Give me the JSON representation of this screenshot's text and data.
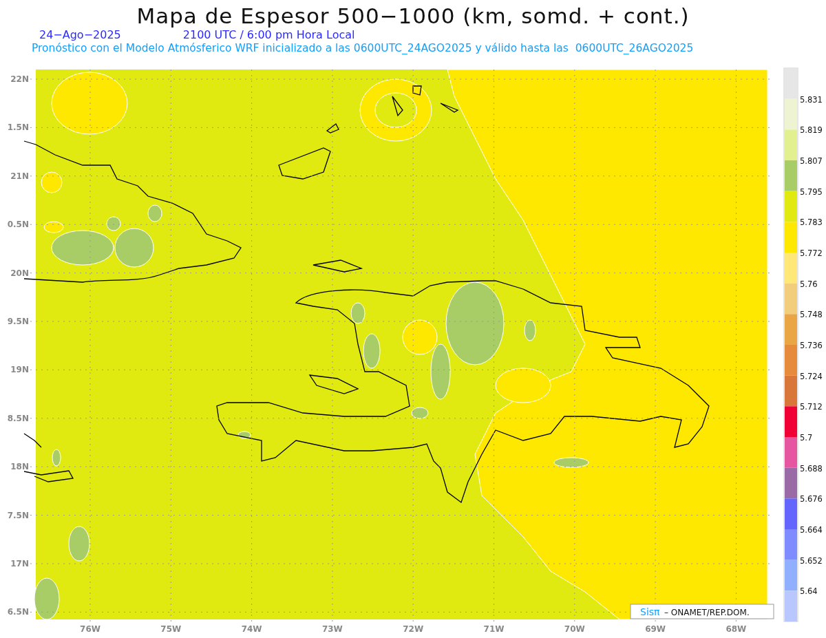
{
  "header": {
    "title": "Mapa de Espesor 500−1000 (km, somd. + cont.)",
    "date": "24−Ago−2025",
    "time": "2100 UTC / 6:00 pm Hora Local",
    "forecast": "Pronóstico con el Modelo Atmósferico WRF inicializado a las 0600UTC_24AGO2025 y válido hasta las  0600UTC_26AGO2025"
  },
  "map": {
    "latitude_labels": [
      "22N",
      "1.5N",
      "21N",
      "0.5N",
      "20N",
      "9.5N",
      "19N",
      "8.5N",
      "18N",
      "7.5N",
      "17N",
      "6.5N"
    ],
    "longitude_labels": [
      "76W",
      "75W",
      "74W",
      "73W",
      "72W",
      "71W",
      "70W",
      "69W",
      "68W"
    ],
    "credit": {
      "brand": "Sisπ",
      "text": "– ONAMET/REP.DOM."
    }
  },
  "legend": {
    "segments": [
      {
        "color": "#e6e6e6"
      },
      {
        "color": "#eef3d2"
      },
      {
        "color": "#e3f08f"
      },
      {
        "color": "#a8cc66"
      },
      {
        "color": "#e0ea10"
      },
      {
        "color": "#ffe800"
      },
      {
        "color": "#ffe878"
      },
      {
        "color": "#f2cd7c"
      },
      {
        "color": "#eaa545"
      },
      {
        "color": "#e68a3c"
      },
      {
        "color": "#d9763a"
      },
      {
        "color": "#f00035"
      },
      {
        "color": "#e655a0"
      },
      {
        "color": "#9a6aa6"
      },
      {
        "color": "#6464ff"
      },
      {
        "color": "#7f8cff"
      },
      {
        "color": "#90b0ff"
      },
      {
        "color": "#b8c8ff"
      }
    ],
    "labels": [
      "5.831",
      "5.819",
      "5.807",
      "5.795",
      "5.783",
      "5.772",
      "5.76",
      "5.748",
      "5.736",
      "5.724",
      "5.712",
      "5.7",
      "5.688",
      "5.676",
      "5.664",
      "5.652",
      "5.64"
    ]
  }
}
